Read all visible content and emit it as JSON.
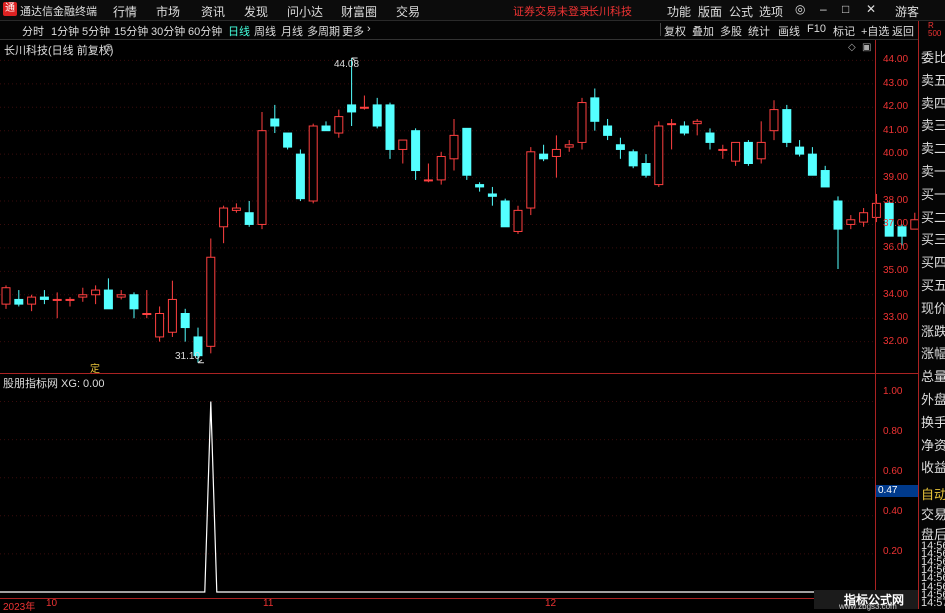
{
  "app": {
    "title": "通达信金融终端",
    "status": "证券交易未登录",
    "stock_link": "长川科技"
  },
  "menu": [
    "行情",
    "市场",
    "资讯",
    "发现",
    "问小达",
    "财富圈",
    "交易"
  ],
  "top_right": [
    "功能",
    "版面",
    "公式",
    "选项",
    "游客"
  ],
  "periods": [
    "分时",
    "1分钟",
    "5分钟",
    "15分钟",
    "30分钟",
    "60分钟",
    "日线",
    "周线",
    "月线",
    "多周期",
    "更多"
  ],
  "active_period": "日线",
  "tools": [
    "复权",
    "叠加",
    "多股",
    "统计",
    "画线",
    "F10",
    "标记",
    "+自选",
    "返回"
  ],
  "main_chart": {
    "title": "长川科技(日线 前复权)",
    "high_label": "44.08",
    "low_label": "31.10",
    "marker": "定"
  },
  "price_axis": [
    "44.00",
    "43.00",
    "42.00",
    "41.00",
    "40.00",
    "39.00",
    "38.00",
    "37.00",
    "36.00",
    "35.00",
    "34.00",
    "33.00",
    "32.00"
  ],
  "indicator": {
    "title": "股朋指标网 XG: 0.00",
    "axis": [
      "1.00",
      "0.80",
      "0.60",
      "0.47",
      "0.40",
      "0.20"
    ]
  },
  "right_panel": [
    "委比",
    "卖五",
    "卖四",
    "卖三",
    "卖二",
    "卖一",
    "买一",
    "买二",
    "买三",
    "买四",
    "买五",
    "现价",
    "涨跌",
    "涨幅",
    "总量",
    "外盘",
    "换手",
    "净资",
    "收益",
    "自动",
    "交易",
    "盘后",
    "14:56",
    "14:56",
    "14:56",
    "14:56",
    "14:56",
    "14:56",
    "14:56",
    "14:57"
  ],
  "dates": [
    "2023年",
    "10",
    "11",
    "12"
  ],
  "watermark": {
    "line1": "指标公式网",
    "line2": "www.zbgs3.com"
  },
  "colors": {
    "up": "#ff4040",
    "down": "#54ffff",
    "axis": "#a22",
    "active": "#4fd"
  },
  "chart_data": {
    "type": "candlestick",
    "title": "长川科技(日线 前复权)",
    "ylim": [
      31.6,
      44.4
    ],
    "candles": [
      {
        "o": 33.6,
        "h": 34.4,
        "l": 33.4,
        "c": 34.3
      },
      {
        "o": 33.8,
        "h": 34.2,
        "l": 33.5,
        "c": 33.6
      },
      {
        "o": 33.6,
        "h": 34.0,
        "l": 33.3,
        "c": 33.9
      },
      {
        "o": 33.9,
        "h": 34.2,
        "l": 33.6,
        "c": 33.8
      },
      {
        "o": 33.8,
        "h": 34.1,
        "l": 33.0,
        "c": 33.8
      },
      {
        "o": 33.8,
        "h": 33.9,
        "l": 33.5,
        "c": 33.8
      },
      {
        "o": 33.9,
        "h": 34.3,
        "l": 33.7,
        "c": 34.0
      },
      {
        "o": 34.0,
        "h": 34.4,
        "l": 33.6,
        "c": 34.2
      },
      {
        "o": 34.2,
        "h": 34.7,
        "l": 33.4,
        "c": 33.4
      },
      {
        "o": 33.9,
        "h": 34.2,
        "l": 33.8,
        "c": 34.0
      },
      {
        "o": 34.0,
        "h": 34.1,
        "l": 33.0,
        "c": 33.4
      },
      {
        "o": 33.2,
        "h": 34.2,
        "l": 33.0,
        "c": 33.2
      },
      {
        "o": 32.2,
        "h": 33.5,
        "l": 32.0,
        "c": 33.2
      },
      {
        "o": 32.4,
        "h": 34.6,
        "l": 32.2,
        "c": 33.8
      },
      {
        "o": 33.2,
        "h": 33.4,
        "l": 32.0,
        "c": 32.6
      },
      {
        "o": 32.2,
        "h": 32.6,
        "l": 31.1,
        "c": 31.4
      },
      {
        "o": 31.8,
        "h": 36.4,
        "l": 31.5,
        "c": 35.6
      },
      {
        "o": 36.9,
        "h": 37.8,
        "l": 36.2,
        "c": 37.7
      },
      {
        "o": 37.6,
        "h": 37.9,
        "l": 37.5,
        "c": 37.7
      },
      {
        "o": 37.5,
        "h": 38.0,
        "l": 36.9,
        "c": 37.0
      },
      {
        "o": 37.0,
        "h": 41.8,
        "l": 36.8,
        "c": 41.0
      },
      {
        "o": 41.5,
        "h": 42.1,
        "l": 40.9,
        "c": 41.2
      },
      {
        "o": 40.9,
        "h": 40.9,
        "l": 40.2,
        "c": 40.3
      },
      {
        "o": 40.0,
        "h": 40.2,
        "l": 38.0,
        "c": 38.1
      },
      {
        "o": 38.0,
        "h": 41.3,
        "l": 37.9,
        "c": 41.2
      },
      {
        "o": 41.2,
        "h": 41.4,
        "l": 41.0,
        "c": 41.0
      },
      {
        "o": 40.9,
        "h": 41.9,
        "l": 40.7,
        "c": 41.6
      },
      {
        "o": 42.1,
        "h": 44.1,
        "l": 41.2,
        "c": 41.8
      },
      {
        "o": 42.0,
        "h": 42.5,
        "l": 41.9,
        "c": 42.0
      },
      {
        "o": 42.1,
        "h": 42.4,
        "l": 41.1,
        "c": 41.2
      },
      {
        "o": 42.1,
        "h": 42.2,
        "l": 39.8,
        "c": 40.2
      },
      {
        "o": 40.2,
        "h": 40.6,
        "l": 39.6,
        "c": 40.6
      },
      {
        "o": 41.0,
        "h": 41.1,
        "l": 38.9,
        "c": 39.3
      },
      {
        "o": 38.9,
        "h": 39.6,
        "l": 38.8,
        "c": 38.9
      },
      {
        "o": 38.9,
        "h": 40.1,
        "l": 38.7,
        "c": 39.9
      },
      {
        "o": 39.8,
        "h": 41.5,
        "l": 39.3,
        "c": 40.8
      },
      {
        "o": 41.1,
        "h": 41.1,
        "l": 38.9,
        "c": 39.1
      },
      {
        "o": 38.7,
        "h": 38.8,
        "l": 38.4,
        "c": 38.6
      },
      {
        "o": 38.3,
        "h": 38.6,
        "l": 37.8,
        "c": 38.2
      },
      {
        "o": 38.0,
        "h": 38.1,
        "l": 36.9,
        "c": 36.9
      },
      {
        "o": 36.7,
        "h": 37.8,
        "l": 36.6,
        "c": 37.6
      },
      {
        "o": 37.7,
        "h": 40.3,
        "l": 37.4,
        "c": 40.1
      },
      {
        "o": 40.0,
        "h": 40.4,
        "l": 39.7,
        "c": 39.8
      },
      {
        "o": 39.9,
        "h": 40.8,
        "l": 39.0,
        "c": 40.2
      },
      {
        "o": 40.3,
        "h": 40.6,
        "l": 40.1,
        "c": 40.4
      },
      {
        "o": 40.5,
        "h": 42.4,
        "l": 40.2,
        "c": 42.2
      },
      {
        "o": 42.4,
        "h": 42.8,
        "l": 41.0,
        "c": 41.4
      },
      {
        "o": 41.2,
        "h": 41.5,
        "l": 40.6,
        "c": 40.8
      },
      {
        "o": 40.4,
        "h": 40.7,
        "l": 39.8,
        "c": 40.2
      },
      {
        "o": 40.1,
        "h": 40.2,
        "l": 39.4,
        "c": 39.5
      },
      {
        "o": 39.6,
        "h": 40.0,
        "l": 39.0,
        "c": 39.1
      },
      {
        "o": 38.7,
        "h": 41.4,
        "l": 38.6,
        "c": 41.2
      },
      {
        "o": 41.3,
        "h": 41.5,
        "l": 40.2,
        "c": 41.3
      },
      {
        "o": 41.2,
        "h": 41.4,
        "l": 40.8,
        "c": 40.9
      },
      {
        "o": 41.3,
        "h": 41.5,
        "l": 40.8,
        "c": 41.4
      },
      {
        "o": 40.9,
        "h": 41.1,
        "l": 40.2,
        "c": 40.5
      },
      {
        "o": 40.2,
        "h": 40.4,
        "l": 39.8,
        "c": 40.2
      },
      {
        "o": 39.7,
        "h": 40.0,
        "l": 39.5,
        "c": 40.5
      },
      {
        "o": 40.5,
        "h": 40.6,
        "l": 39.5,
        "c": 39.6
      },
      {
        "o": 39.8,
        "h": 41.4,
        "l": 39.6,
        "c": 40.5
      },
      {
        "o": 41.0,
        "h": 42.3,
        "l": 40.6,
        "c": 41.9
      },
      {
        "o": 41.9,
        "h": 42.1,
        "l": 40.3,
        "c": 40.5
      },
      {
        "o": 40.3,
        "h": 40.6,
        "l": 39.9,
        "c": 40.0
      },
      {
        "o": 40.0,
        "h": 40.3,
        "l": 39.1,
        "c": 39.1
      },
      {
        "o": 39.3,
        "h": 39.5,
        "l": 38.6,
        "c": 38.6
      },
      {
        "o": 38.0,
        "h": 38.2,
        "l": 35.1,
        "c": 36.8
      },
      {
        "o": 37.0,
        "h": 37.4,
        "l": 36.8,
        "c": 37.2
      },
      {
        "o": 37.1,
        "h": 37.7,
        "l": 36.9,
        "c": 37.5
      },
      {
        "o": 37.3,
        "h": 38.3,
        "l": 37.1,
        "c": 37.9
      },
      {
        "o": 37.9,
        "h": 38.0,
        "l": 36.5,
        "c": 36.5
      },
      {
        "o": 36.9,
        "h": 37.0,
        "l": 36.1,
        "c": 36.5
      },
      {
        "o": 36.8,
        "h": 37.5,
        "l": 36.8,
        "c": 37.2
      },
      {
        "o": 37.4,
        "h": 38.7,
        "l": 36.2,
        "c": 36.4
      },
      {
        "o": 36.3,
        "h": 36.7,
        "l": 34.6,
        "c": 34.4
      }
    ],
    "indicator": {
      "name": "XG",
      "value": 0.0,
      "ylim": [
        0,
        1.05
      ],
      "spike_index": 16,
      "spike_value": 1.0
    }
  }
}
